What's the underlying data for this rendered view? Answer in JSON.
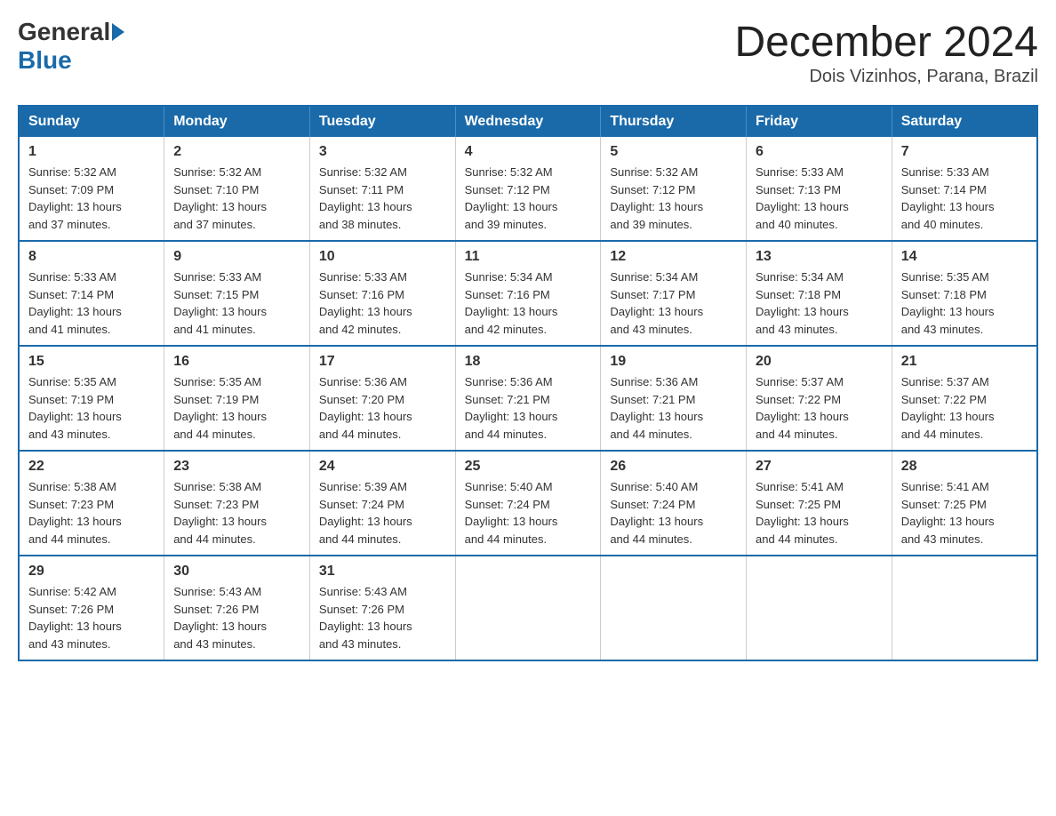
{
  "header": {
    "logo_general": "General",
    "logo_blue": "Blue",
    "month_title": "December 2024",
    "location": "Dois Vizinhos, Parana, Brazil"
  },
  "weekdays": [
    "Sunday",
    "Monday",
    "Tuesday",
    "Wednesday",
    "Thursday",
    "Friday",
    "Saturday"
  ],
  "weeks": [
    [
      {
        "day": "1",
        "sunrise": "5:32 AM",
        "sunset": "7:09 PM",
        "daylight": "13 hours and 37 minutes."
      },
      {
        "day": "2",
        "sunrise": "5:32 AM",
        "sunset": "7:10 PM",
        "daylight": "13 hours and 37 minutes."
      },
      {
        "day": "3",
        "sunrise": "5:32 AM",
        "sunset": "7:11 PM",
        "daylight": "13 hours and 38 minutes."
      },
      {
        "day": "4",
        "sunrise": "5:32 AM",
        "sunset": "7:12 PM",
        "daylight": "13 hours and 39 minutes."
      },
      {
        "day": "5",
        "sunrise": "5:32 AM",
        "sunset": "7:12 PM",
        "daylight": "13 hours and 39 minutes."
      },
      {
        "day": "6",
        "sunrise": "5:33 AM",
        "sunset": "7:13 PM",
        "daylight": "13 hours and 40 minutes."
      },
      {
        "day": "7",
        "sunrise": "5:33 AM",
        "sunset": "7:14 PM",
        "daylight": "13 hours and 40 minutes."
      }
    ],
    [
      {
        "day": "8",
        "sunrise": "5:33 AM",
        "sunset": "7:14 PM",
        "daylight": "13 hours and 41 minutes."
      },
      {
        "day": "9",
        "sunrise": "5:33 AM",
        "sunset": "7:15 PM",
        "daylight": "13 hours and 41 minutes."
      },
      {
        "day": "10",
        "sunrise": "5:33 AM",
        "sunset": "7:16 PM",
        "daylight": "13 hours and 42 minutes."
      },
      {
        "day": "11",
        "sunrise": "5:34 AM",
        "sunset": "7:16 PM",
        "daylight": "13 hours and 42 minutes."
      },
      {
        "day": "12",
        "sunrise": "5:34 AM",
        "sunset": "7:17 PM",
        "daylight": "13 hours and 43 minutes."
      },
      {
        "day": "13",
        "sunrise": "5:34 AM",
        "sunset": "7:18 PM",
        "daylight": "13 hours and 43 minutes."
      },
      {
        "day": "14",
        "sunrise": "5:35 AM",
        "sunset": "7:18 PM",
        "daylight": "13 hours and 43 minutes."
      }
    ],
    [
      {
        "day": "15",
        "sunrise": "5:35 AM",
        "sunset": "7:19 PM",
        "daylight": "13 hours and 43 minutes."
      },
      {
        "day": "16",
        "sunrise": "5:35 AM",
        "sunset": "7:19 PM",
        "daylight": "13 hours and 44 minutes."
      },
      {
        "day": "17",
        "sunrise": "5:36 AM",
        "sunset": "7:20 PM",
        "daylight": "13 hours and 44 minutes."
      },
      {
        "day": "18",
        "sunrise": "5:36 AM",
        "sunset": "7:21 PM",
        "daylight": "13 hours and 44 minutes."
      },
      {
        "day": "19",
        "sunrise": "5:36 AM",
        "sunset": "7:21 PM",
        "daylight": "13 hours and 44 minutes."
      },
      {
        "day": "20",
        "sunrise": "5:37 AM",
        "sunset": "7:22 PM",
        "daylight": "13 hours and 44 minutes."
      },
      {
        "day": "21",
        "sunrise": "5:37 AM",
        "sunset": "7:22 PM",
        "daylight": "13 hours and 44 minutes."
      }
    ],
    [
      {
        "day": "22",
        "sunrise": "5:38 AM",
        "sunset": "7:23 PM",
        "daylight": "13 hours and 44 minutes."
      },
      {
        "day": "23",
        "sunrise": "5:38 AM",
        "sunset": "7:23 PM",
        "daylight": "13 hours and 44 minutes."
      },
      {
        "day": "24",
        "sunrise": "5:39 AM",
        "sunset": "7:24 PM",
        "daylight": "13 hours and 44 minutes."
      },
      {
        "day": "25",
        "sunrise": "5:40 AM",
        "sunset": "7:24 PM",
        "daylight": "13 hours and 44 minutes."
      },
      {
        "day": "26",
        "sunrise": "5:40 AM",
        "sunset": "7:24 PM",
        "daylight": "13 hours and 44 minutes."
      },
      {
        "day": "27",
        "sunrise": "5:41 AM",
        "sunset": "7:25 PM",
        "daylight": "13 hours and 44 minutes."
      },
      {
        "day": "28",
        "sunrise": "5:41 AM",
        "sunset": "7:25 PM",
        "daylight": "13 hours and 43 minutes."
      }
    ],
    [
      {
        "day": "29",
        "sunrise": "5:42 AM",
        "sunset": "7:26 PM",
        "daylight": "13 hours and 43 minutes."
      },
      {
        "day": "30",
        "sunrise": "5:43 AM",
        "sunset": "7:26 PM",
        "daylight": "13 hours and 43 minutes."
      },
      {
        "day": "31",
        "sunrise": "5:43 AM",
        "sunset": "7:26 PM",
        "daylight": "13 hours and 43 minutes."
      },
      null,
      null,
      null,
      null
    ]
  ]
}
